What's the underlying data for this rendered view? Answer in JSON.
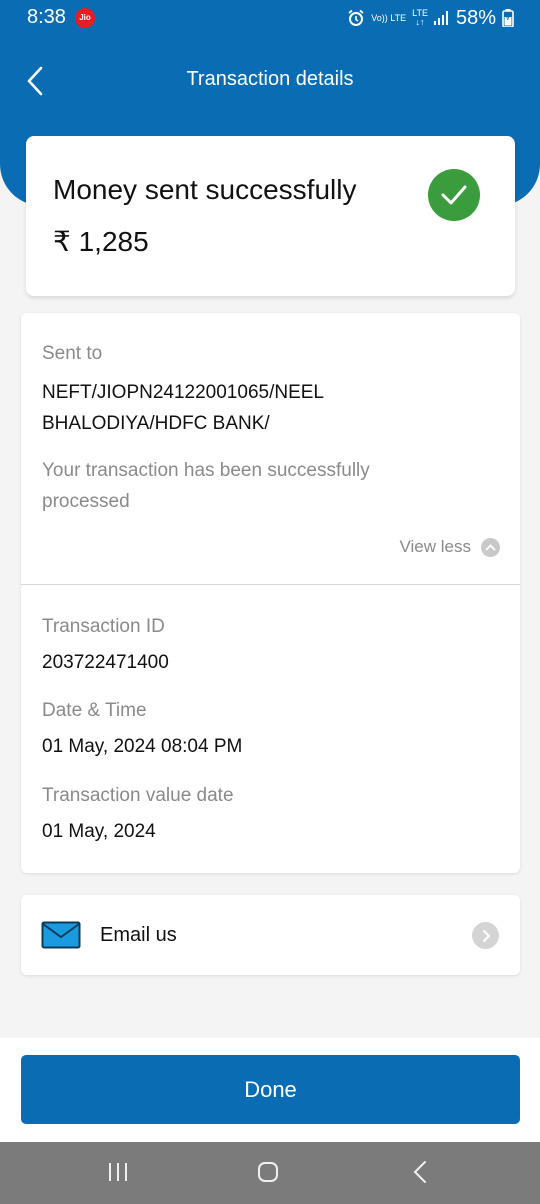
{
  "status_bar": {
    "time": "8:38",
    "carrier_badge": "Jio",
    "network_top": "Vo)) LTE",
    "network_bottom": "LTE",
    "battery": "58%"
  },
  "header": {
    "title": "Transaction details",
    "back_icon": "chevron-left-icon"
  },
  "success": {
    "title": "Money sent successfully",
    "amount": "₹ 1,285",
    "status_icon": "check-circle-icon",
    "status_color": "#3a9c3d"
  },
  "details": {
    "sent_to_label": "Sent to",
    "sent_to_value": "NEFT/JIOPN24122001065/NEEL BHALODIYA/HDFC BANK/",
    "status_message": "Your transaction has been successfully processed",
    "view_less_label": "View less",
    "transaction_id_label": "Transaction ID",
    "transaction_id_value": "203722471400",
    "date_time_label": "Date & Time",
    "date_time_value": "01 May, 2024 08:04 PM",
    "value_date_label": "Transaction value date",
    "value_date_value": "01 May, 2024"
  },
  "email": {
    "label": "Email us",
    "icon": "envelope-icon"
  },
  "footer": {
    "done_label": "Done"
  },
  "colors": {
    "brand_blue": "#0a6db3"
  }
}
